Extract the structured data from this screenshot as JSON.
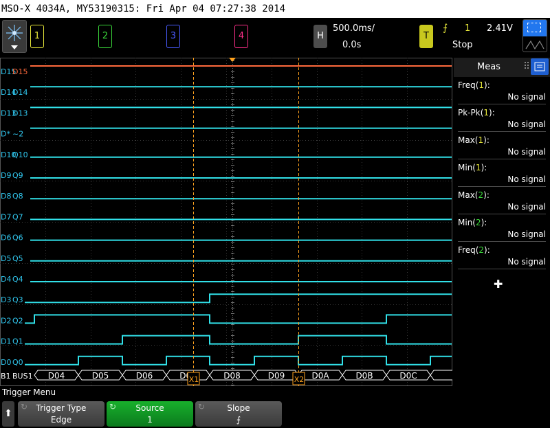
{
  "title_bar": "MSO-X 4034A, MY53190315: Fri Apr 04 07:27:38 2014",
  "channels": [
    {
      "label": "1",
      "color": "#e8e83a"
    },
    {
      "label": "2",
      "color": "#3ad63a"
    },
    {
      "label": "3",
      "color": "#4a5cff"
    },
    {
      "label": "4",
      "color": "#ff2f8a"
    }
  ],
  "horizontal": {
    "button": "H",
    "timebase": "500.0ms/",
    "delay": "0.0s"
  },
  "trigger": {
    "button": "T",
    "source": "1",
    "level": "2.41V",
    "status": "Stop"
  },
  "digital": [
    {
      "tag": "D15",
      "label": "D15",
      "high": true
    },
    {
      "tag": "D14",
      "label": "D14",
      "high": true
    },
    {
      "tag": "D13",
      "label": "D13",
      "high": true
    },
    {
      "tag": "D*",
      "label": "~2",
      "high": true
    },
    {
      "tag": "D10",
      "label": "Q10",
      "high": false
    },
    {
      "tag": "D9",
      "label": "Q9",
      "high": false
    },
    {
      "tag": "D8",
      "label": "Q8",
      "high": false
    },
    {
      "tag": "D7",
      "label": "Q7",
      "high": false
    },
    {
      "tag": "D6",
      "label": "Q6",
      "high": false
    },
    {
      "tag": "D5",
      "label": "Q5",
      "high": false
    },
    {
      "tag": "D4",
      "label": "Q4",
      "high": false
    },
    {
      "tag": "D3",
      "label": "Q3",
      "high": false
    },
    {
      "tag": "D2",
      "label": "Q2",
      "high": false
    },
    {
      "tag": "D1",
      "label": "Q1",
      "high": false
    },
    {
      "tag": "D0",
      "label": "Q0",
      "high": false
    }
  ],
  "bus": {
    "tag": "B1",
    "label": "BUS1",
    "values": [
      "D04",
      "D05",
      "D06",
      "D07",
      "D08",
      "D09",
      "D0A",
      "D0B",
      "D0C"
    ]
  },
  "cursors": [
    {
      "label": "X1"
    },
    {
      "label": "X2"
    }
  ],
  "meas_panel": {
    "tab": "Meas",
    "items": [
      {
        "name": "Freq",
        "ch": "1",
        "value": "No signal",
        "color": "#e8e83a"
      },
      {
        "name": "Pk-Pk",
        "ch": "1",
        "value": "No signal",
        "color": "#e8e83a"
      },
      {
        "name": "Max",
        "ch": "1",
        "value": "No signal",
        "color": "#e8e83a"
      },
      {
        "name": "Min",
        "ch": "1",
        "value": "No signal",
        "color": "#e8e83a"
      },
      {
        "name": "Max",
        "ch": "2",
        "value": "No signal",
        "color": "#3ad63a"
      },
      {
        "name": "Min",
        "ch": "2",
        "value": "No signal",
        "color": "#3ad63a"
      },
      {
        "name": "Freq",
        "ch": "2",
        "value": "No signal",
        "color": "#3ad63a"
      }
    ],
    "add_label": "✚"
  },
  "softkeys": {
    "menu_title": "Trigger Menu",
    "keys": [
      {
        "label": "Trigger Type",
        "value": "Edge"
      },
      {
        "label": "Source",
        "value": "1"
      },
      {
        "label": "Slope",
        "value": "⨍"
      }
    ]
  },
  "colors": {
    "trace": "#31e0e8",
    "d15": "#ff6a3c",
    "tag": "#31c8f0",
    "cursor": "#ffa21e",
    "source_key": "#0f9a24"
  }
}
